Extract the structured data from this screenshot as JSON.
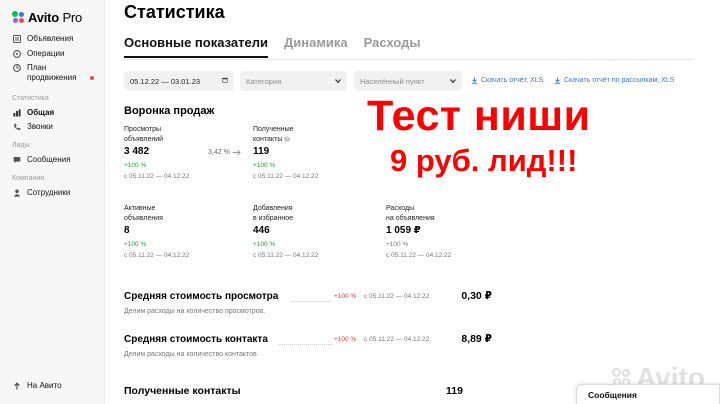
{
  "brand": {
    "name": "Avito",
    "suffix": " Pro",
    "colors": {
      "green": "#00c754",
      "blue": "#2f7bd8",
      "red": "#ff4053",
      "purple": "#965eeb"
    }
  },
  "sidebar": {
    "items": [
      {
        "label": "Объявления",
        "icon": "document-icon"
      },
      {
        "label": "Операции",
        "icon": "operations-icon"
      },
      {
        "label": "План продвижения",
        "line1": "План",
        "line2": "продвижения",
        "icon": "promotion-plan-icon"
      }
    ],
    "sections": [
      {
        "title": "Статистика",
        "items": [
          {
            "label": "Общая",
            "icon": "chart-icon",
            "active": true
          },
          {
            "label": "Звонки",
            "icon": "phone-icon"
          }
        ]
      },
      {
        "title": "Лиды",
        "items": [
          {
            "label": "Сообщения",
            "icon": "chat-icon"
          }
        ]
      },
      {
        "title": "Компания",
        "items": [
          {
            "label": "Сотрудники",
            "icon": "user-icon"
          }
        ]
      }
    ],
    "back_link": "На Авито"
  },
  "page": {
    "title": "Статистика",
    "tabs": [
      {
        "label": "Основные показатели",
        "active": true
      },
      {
        "label": "Динамика"
      },
      {
        "label": "Расходы"
      }
    ]
  },
  "filters": {
    "date_range": "05.12.22 — 03.01.23",
    "category_placeholder": "Категория",
    "city_placeholder": "Населённый пункт",
    "download_xls": "Скачать отчёт, XLS",
    "download_mailing_xls": "Скачать отчёт по рассылкам, XLS"
  },
  "funnel": {
    "title": "Воронка продаж",
    "conversion": "3,42 %",
    "metrics": [
      {
        "label1": "Просмотры",
        "label2": "объявлений",
        "value": "3 482",
        "delta": "+100 %",
        "period": "с 05.11.22 — 04.12.22"
      },
      {
        "label1": "Полученные",
        "label2": "контакты",
        "value": "119",
        "delta": "+100 %",
        "period": "с 05.11.22 — 04.12.22"
      },
      {
        "label1": "Активные",
        "label2": "объявления",
        "value": "8",
        "delta": "+100 %",
        "period": "с 05.11.22 — 04.12.22"
      },
      {
        "label1": "Добавления",
        "label2": "в избранное",
        "value": "446",
        "delta": "+100 %",
        "period": "с 05.11.22 — 04.12.22"
      },
      {
        "label1": "Расходы",
        "label2": "на объявления",
        "value": "1 059 ₽",
        "delta": "+100 %",
        "period": "с 05.11.22 — 04.12.22"
      }
    ]
  },
  "overlay": {
    "line1": "Тест ниши",
    "line2": "9 руб. лид!!!"
  },
  "averages": [
    {
      "title": "Средняя стоимость просмотра",
      "delta": "+100 %",
      "period": "с 05.11.22 — 04.12.22",
      "value": "0,30 ₽",
      "sub": "Делим расходы на количество просмотров."
    },
    {
      "title": "Средняя стоимость контакта",
      "delta": "+100 %",
      "period": "с 05.11.22 — 04.12.22",
      "value": "8,89 ₽",
      "sub": "Делим расходы на количество контактов."
    }
  ],
  "contacts": {
    "title": "Полученные контакты",
    "value": "119"
  },
  "messages_bar": {
    "label": "Сообщения"
  },
  "watermark": "Avito"
}
